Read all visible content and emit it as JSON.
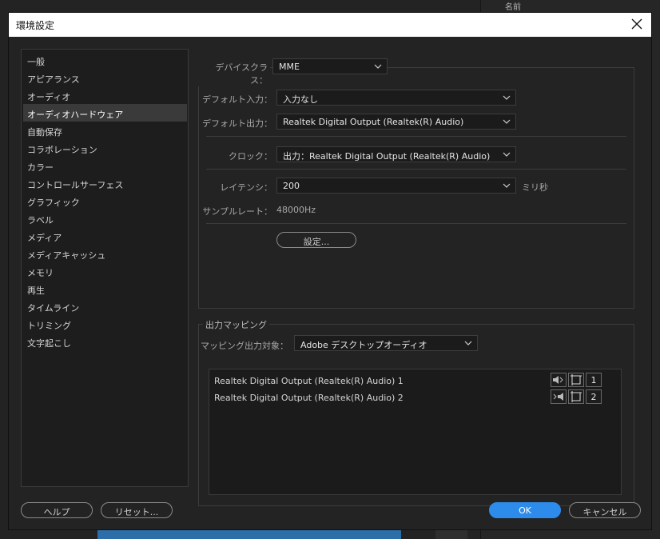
{
  "background": {
    "header_name": "名前"
  },
  "dialog": {
    "title": "環境設定"
  },
  "sidebar": {
    "items": [
      {
        "label": "一般"
      },
      {
        "label": "アピアランス"
      },
      {
        "label": "オーディオ"
      },
      {
        "label": "オーディオハードウェア",
        "selected": true
      },
      {
        "label": "自動保存"
      },
      {
        "label": "コラボレーション"
      },
      {
        "label": "カラー"
      },
      {
        "label": "コントロールサーフェス"
      },
      {
        "label": "グラフィック"
      },
      {
        "label": "ラベル"
      },
      {
        "label": "メディア"
      },
      {
        "label": "メディアキャッシュ"
      },
      {
        "label": "メモリ"
      },
      {
        "label": "再生"
      },
      {
        "label": "タイムライン"
      },
      {
        "label": "トリミング"
      },
      {
        "label": "文字起こし"
      }
    ]
  },
  "hardware": {
    "device_class_label": "デバイスクラス：",
    "device_class_value": "MME",
    "default_input_label": "デフォルト入力：",
    "default_input_value": "入力なし",
    "default_output_label": "デフォルト出力：",
    "default_output_value": "Realtek Digital Output (Realtek(R) Audio)",
    "clock_label": "クロック：",
    "clock_value": "出力：Realtek Digital Output (Realtek(R) Audio)",
    "latency_label": "レイテンシ：",
    "latency_value": "200",
    "latency_unit": "ミリ秒",
    "sample_rate_label": "サンプルレート：",
    "sample_rate_value": "48000Hz",
    "settings_button": "設定..."
  },
  "output_mapping": {
    "legend": "出力マッピング",
    "target_label": "マッピング出力対象：",
    "target_value": "Adobe デスクトップオーディオ",
    "rows": [
      {
        "name": "Realtek Digital Output (Realtek(R) Audio) 1",
        "channel": "1"
      },
      {
        "name": "Realtek Digital Output (Realtek(R) Audio) 2",
        "channel": "2"
      }
    ]
  },
  "footer": {
    "help": "ヘルプ",
    "reset": "リセット...",
    "ok": "OK",
    "cancel": "キャンセル"
  },
  "colors": {
    "accent": "#2d8ceb",
    "dialog_bg": "#232323",
    "selected_item": "#3a3a3a"
  }
}
